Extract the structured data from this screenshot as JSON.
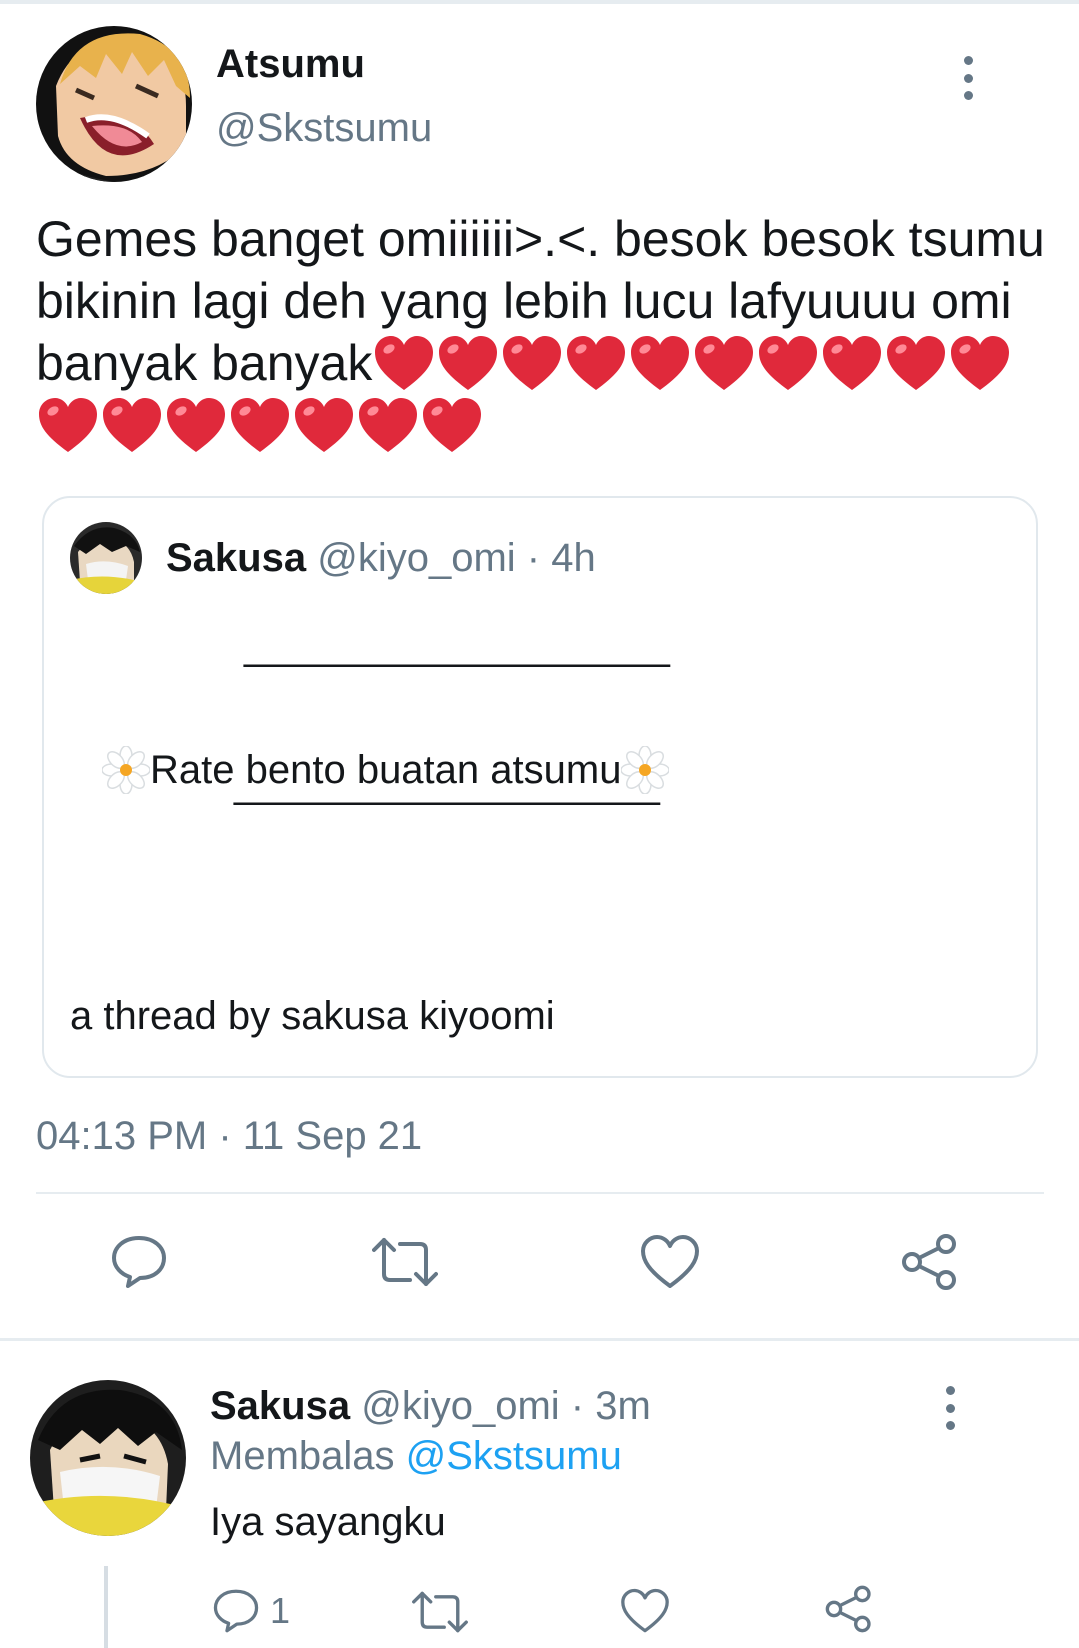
{
  "tweet": {
    "author_name": "Atsumu",
    "author_handle": "@Skstsumu",
    "text": "Gemes banget omiiiiii>.<. besok besok tsumu bikinin lagi deh yang lebih lucu lafyuuuu omi banyak banyak",
    "heart_count": 17,
    "heart_color": "#e0293b",
    "timestamp": "04:13 PM · 11 Sep 21",
    "quote": {
      "name": "Sakusa",
      "handle": "@kiyo_omi",
      "time": "· 4h",
      "line_top": "____________________",
      "rate_text": "Rate bento buatan atsumu",
      "line_bottom": "____________________",
      "thread_text": "a thread by sakusa kiyoomi"
    },
    "actions": [
      "reply-icon",
      "retweet-icon",
      "like-icon",
      "share-icon"
    ]
  },
  "reply": {
    "name": "Sakusa",
    "handle": "@kiyo_omi",
    "time": "· 3m",
    "replying_label": "Membalas",
    "replying_to": "@Skstsumu",
    "text": "Iya sayangku",
    "reply_count": "1",
    "actions": [
      "reply-icon",
      "retweet-icon",
      "like-icon",
      "share-icon"
    ]
  },
  "colors": {
    "secondary_text": "#657786",
    "link": "#1da1f2",
    "divider": "#e6ecf0"
  }
}
